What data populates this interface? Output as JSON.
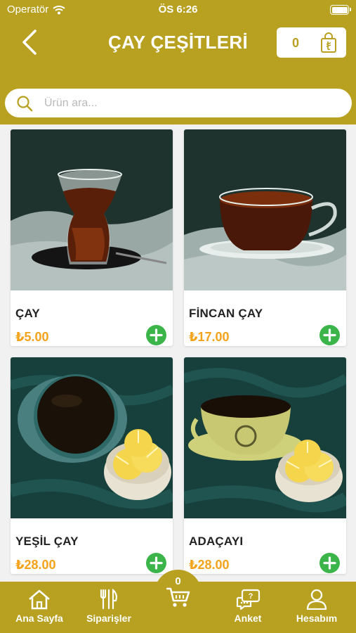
{
  "status_bar": {
    "carrier": "Operatör",
    "time": "ÖS 6:26"
  },
  "header": {
    "title": "ÇAY ÇEŞİTLERİ",
    "cart_count": "0"
  },
  "search": {
    "placeholder": "Ürün ara..."
  },
  "products": [
    {
      "name": "ÇAY",
      "price": "₺5.00"
    },
    {
      "name": "FİNCAN ÇAY",
      "price": "₺17.00"
    },
    {
      "name": "YEŞİL ÇAY",
      "price": "₺28.00"
    },
    {
      "name": "ADAÇAYI",
      "price": "₺28.00"
    }
  ],
  "tabbar": {
    "home_label": "Ana Sayfa",
    "orders_label": "Siparişler",
    "cart_count": "0",
    "survey_label": "Anket",
    "account_label": "Hesabım"
  },
  "colors": {
    "brand": "#b8a020",
    "price": "#f5a21b",
    "add": "#3bb54a"
  }
}
